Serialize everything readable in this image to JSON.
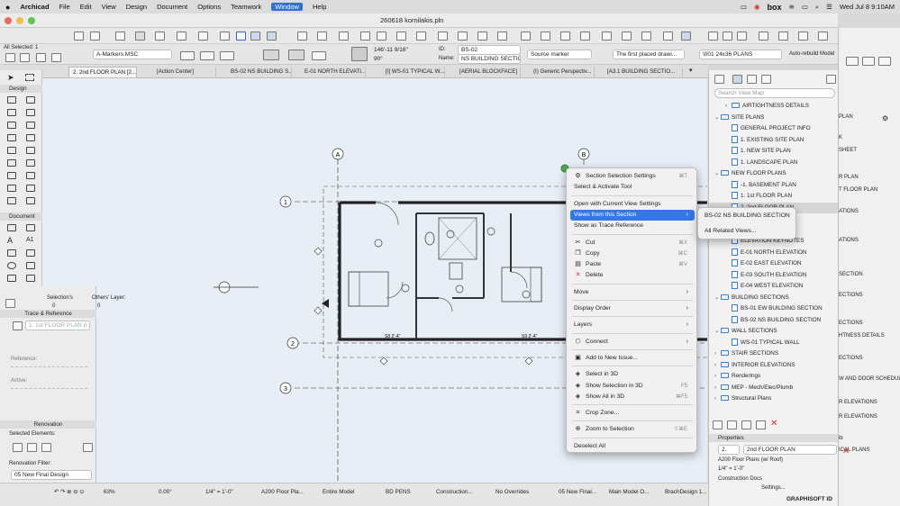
{
  "menubar": {
    "app": "Archicad",
    "items": [
      "File",
      "Edit",
      "View",
      "Design",
      "Document",
      "Options",
      "Teamwork",
      "Window",
      "Help"
    ],
    "active": "Window",
    "box": "box",
    "clock": "Wed Jul 8  9:10AM"
  },
  "window": {
    "title": "260618 kornilakis.pln"
  },
  "toolbar": {
    "all_selected": "All Selected: 1",
    "layer": "A-Markers.MSC",
    "dims_a": "146'-11 9/16\"",
    "angle": "90°",
    "id_label": "ID:",
    "id_value": "BS-02",
    "name_label": "Name:",
    "name_value": "NS BUILDING SECTION",
    "source": "Source marker",
    "placed": "The first placed drawi...",
    "plans": "\\001 24x36 PLANS",
    "rebuild": "Auto-rebuild Model"
  },
  "tabs": [
    "2. 2nd FLOOR PLAN [2...",
    "[Action Center]",
    "BS-02 NS BUILDING S...",
    "E-01 NORTH ELEVATI...",
    "[I] WS-01 TYPICAL W...",
    "[AERIAL BLOCKFACE]",
    "(I) Generic Perspectiv...",
    "[A3.1 BUILDING SECTIO..."
  ],
  "toolbox": {
    "design": "Design",
    "document": "Document"
  },
  "trace": {
    "selections": "Selection's",
    "others_layer": "Others' Layer:",
    "sel_count": "0",
    "other_count": "0",
    "title": "Trace & Reference",
    "ref_item": "1. 1st FLOOR PLAN (I...",
    "reference": "Reference:",
    "active": "Active:",
    "renovation": "Renovation",
    "selected_elements": "Selected Elements:",
    "filter_label": "Renovation Filter:",
    "filter_value": "05 New Final Design"
  },
  "grid": {
    "a": "A",
    "b": "B",
    "r1": "1",
    "r2": "2",
    "r3": "3",
    "s1": "S8 2'-4\"",
    "s2": "S9 2'-4\""
  },
  "context_menu": [
    {
      "label": "Section Selection Settings",
      "shortcut": "⌘T",
      "icon": "settings-icon",
      "glyph": "⚙"
    },
    {
      "label": "Select & Activate Tool"
    },
    {
      "sep": true
    },
    {
      "label": "Open with Current View Settings"
    },
    {
      "label": "Views from this Section",
      "submenu": true,
      "highlight": true
    },
    {
      "label": "Show as Trace Reference"
    },
    {
      "sep": true
    },
    {
      "label": "Cut",
      "shortcut": "⌘X",
      "icon": "scissors-icon",
      "glyph": "✂"
    },
    {
      "label": "Copy",
      "shortcut": "⌘C",
      "icon": "copy-icon",
      "glyph": "❐"
    },
    {
      "label": "Paste",
      "shortcut": "⌘V",
      "icon": "paste-icon",
      "glyph": "▤"
    },
    {
      "label": "Delete",
      "icon": "delete-icon",
      "glyph": "✕"
    },
    {
      "sep": true
    },
    {
      "label": "Move",
      "submenu": true
    },
    {
      "sep": true
    },
    {
      "label": "Display Order",
      "submenu": true
    },
    {
      "sep": true
    },
    {
      "label": "Layers",
      "submenu": true
    },
    {
      "sep": true
    },
    {
      "label": "Connect",
      "submenu": true,
      "icon": "connect-icon",
      "glyph": "⬡"
    },
    {
      "sep": true
    },
    {
      "label": "Add to New Issue...",
      "icon": "issue-icon",
      "glyph": "▣"
    },
    {
      "sep": true
    },
    {
      "label": "Select in 3D",
      "icon": "cube-icon",
      "glyph": "◈"
    },
    {
      "label": "Show Selection in 3D",
      "shortcut": "F5",
      "icon": "cube-icon",
      "glyph": "◈"
    },
    {
      "label": "Show All in 3D",
      "shortcut": "⌘F5",
      "icon": "cube-icon",
      "glyph": "◈"
    },
    {
      "sep": true
    },
    {
      "label": "Crop Zone...",
      "icon": "crop-icon",
      "glyph": "⌗"
    },
    {
      "sep": true
    },
    {
      "label": "Zoom to Selection",
      "shortcut": "⇧⌘E",
      "icon": "zoom-icon",
      "glyph": "⊕"
    },
    {
      "sep": true
    },
    {
      "label": "Deselect All"
    }
  ],
  "submenu": [
    "BS-02 NS BUILDING SECTION",
    "All Related Views..."
  ],
  "navigator": {
    "search": "Search View Map",
    "rows": [
      {
        "t": "AIRTIGHTNESS DETAILS",
        "lvl": 2,
        "k": "fold"
      },
      {
        "t": "SITE PLANS",
        "lvl": 1,
        "k": "fold",
        "open": true
      },
      {
        "t": "GENERAL PROJECT INFO",
        "lvl": 2,
        "k": "doc"
      },
      {
        "t": "1. EXISTING SITE PLAN",
        "lvl": 2,
        "k": "doc"
      },
      {
        "t": "1. NEW SITE PLAN",
        "lvl": 2,
        "k": "doc"
      },
      {
        "t": "1. LANDSCAPE PLAN",
        "lvl": 2,
        "k": "doc"
      },
      {
        "t": "NEW FLOOR PLANS",
        "lvl": 1,
        "k": "fold",
        "open": true
      },
      {
        "t": "-1. BASEMENT PLAN",
        "lvl": 2,
        "k": "doc"
      },
      {
        "t": "1. 1st FLOOR PLAN",
        "lvl": 2,
        "k": "doc"
      },
      {
        "t": "2. 2nd FLOOR PLAN",
        "lvl": 2,
        "k": "doc",
        "sel": true
      },
      {
        "t": "3. ROOF PLAN",
        "lvl": 2,
        "k": "doc"
      },
      {
        "t": "ELEVATIONS",
        "lvl": 1,
        "k": "fold",
        "open": true
      },
      {
        "t": "ELEVATION KEYNOTES",
        "lvl": 2,
        "k": "doc"
      },
      {
        "t": "E-01 NORTH ELEVATION",
        "lvl": 2,
        "k": "doc"
      },
      {
        "t": "E-02 EAST ELEVATION",
        "lvl": 2,
        "k": "doc"
      },
      {
        "t": "E-03 SOUTH ELEVATION",
        "lvl": 2,
        "k": "doc"
      },
      {
        "t": "E-04 WEST ELEVATION",
        "lvl": 2,
        "k": "doc"
      },
      {
        "t": "BUILDING SECTIONS",
        "lvl": 1,
        "k": "fold",
        "open": true
      },
      {
        "t": "BS-01 EW BUILDING SECTION",
        "lvl": 2,
        "k": "doc"
      },
      {
        "t": "BS-02 NS BUILDING SECTION",
        "lvl": 2,
        "k": "doc"
      },
      {
        "t": "WALL SECTIONS",
        "lvl": 1,
        "k": "fold",
        "open": true
      },
      {
        "t": "WS-01 TYPICAL WALL",
        "lvl": 2,
        "k": "doc"
      },
      {
        "t": "STAIR SECTIONS",
        "lvl": 1,
        "k": "fold"
      },
      {
        "t": "INTERIOR ELEVATIONS",
        "lvl": 1,
        "k": "fold"
      },
      {
        "t": "Renderings",
        "lvl": 1,
        "k": "fold"
      },
      {
        "t": "MEP - Mech/Elec/Plumb",
        "lvl": 1,
        "k": "fold"
      },
      {
        "t": "Structural Plans",
        "lvl": 1,
        "k": "fold"
      }
    ],
    "properties": "Properties",
    "prop_id": "2.",
    "prop_name": "2nd FLOOR PLAN",
    "prop_combo": "A200 Floor Plans (w/ Roof)",
    "prop_scale": "1/4\"  =  1'-0\"",
    "prop_docs": "Construction Docs",
    "settings": "Settings...",
    "brand": "GRAPHISOFT ID"
  },
  "backwin": [
    "PLAN",
    "K",
    "SHEET",
    "R PLAN",
    "T FLOOR PLAN",
    "ATIONS",
    "ATIONS",
    "SECTION",
    "ECTIONS",
    "ECTIONS",
    "HTNESS DETAILS",
    "ECTIONS",
    "W AND DOOR SCHEDULE",
    "R ELEVATIONS",
    "R ELEVATIONS",
    "lb",
    "ICAL PLANS"
  ],
  "status": {
    "zoom": "63%",
    "angle": "0.00°",
    "scale": "1/4\"  =  1'-0\"",
    "combo": "A200 Floor Pla...",
    "model": "Entire Model",
    "pens": "BD PENS",
    "layer": "Construction...",
    "override": "No Overrides",
    "reno": "05 New Final...",
    "mvo": "Main Model O...",
    "dim": "BrachDesign 1..."
  }
}
